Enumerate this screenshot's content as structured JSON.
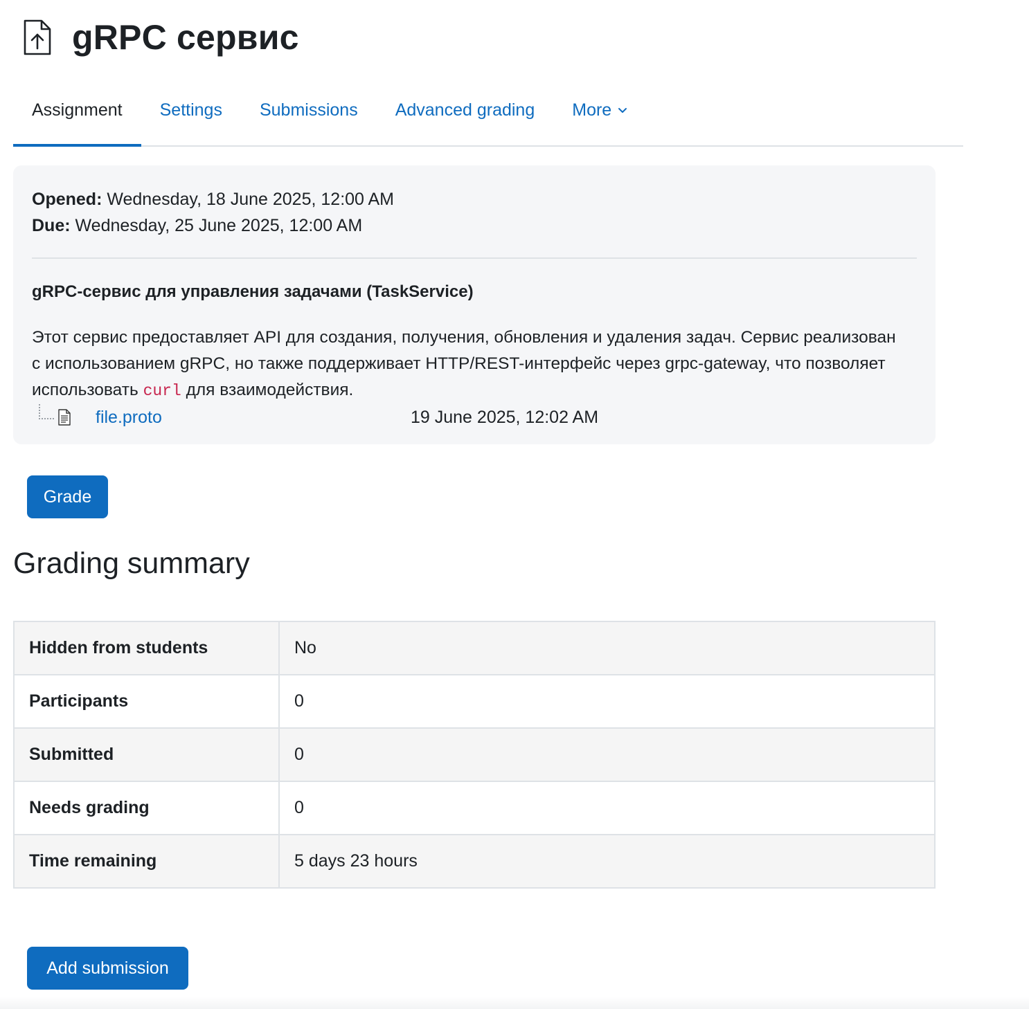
{
  "header": {
    "title": "gRPC сервис",
    "icon": "file-upload-icon"
  },
  "tabs": [
    {
      "label": "Assignment",
      "active": true
    },
    {
      "label": "Settings",
      "active": false
    },
    {
      "label": "Submissions",
      "active": false
    },
    {
      "label": "Advanced grading",
      "active": false
    },
    {
      "label": "More",
      "active": false
    }
  ],
  "dates": {
    "opened_label": "Opened:",
    "opened_value": "Wednesday, 18 June 2025, 12:00 AM",
    "due_label": "Due:",
    "due_value": "Wednesday, 25 June 2025, 12:00 AM"
  },
  "intro": {
    "heading": "gRPC-сервис для управления задачами (TaskService)",
    "text_before_code": "Этот сервис предоставляет API для создания, получения, обновления и удаления задач. Сервис реализован с использованием gRPC, но также поддерживает HTTP/REST-интерфейс через grpc-gateway, что позволяет использовать ",
    "code": "curl",
    "text_after_code": " для взаимодействия."
  },
  "attachment": {
    "filename": "file.proto",
    "date": "19 June 2025, 12:02 AM"
  },
  "buttons": {
    "grade": "Grade",
    "add_submission": "Add submission"
  },
  "summary": {
    "heading": "Grading summary",
    "rows": [
      {
        "label": "Hidden from students",
        "value": "No"
      },
      {
        "label": "Participants",
        "value": "0"
      },
      {
        "label": "Submitted",
        "value": "0"
      },
      {
        "label": "Needs grading",
        "value": "0"
      },
      {
        "label": "Time remaining",
        "value": "5 days 23 hours"
      }
    ]
  },
  "colors": {
    "link": "#0f6cbf",
    "button_bg": "#0f6cbf",
    "text": "#1d2125",
    "box_bg": "#f5f6f8",
    "code": "#c7254e"
  }
}
